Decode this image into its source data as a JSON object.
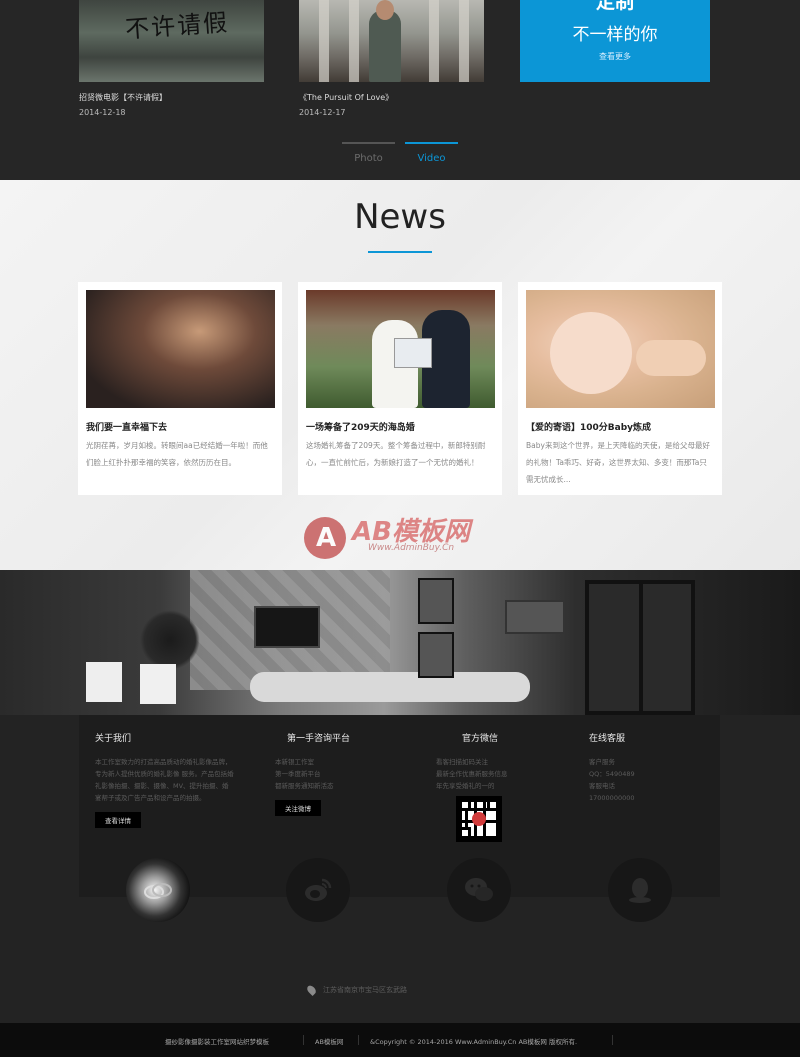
{
  "videos": [
    {
      "title": "招贤微电影【不许请假】",
      "date": "2014-12-18",
      "thumb_text": "不许请假"
    },
    {
      "title": "《The Pursuit Of Love》",
      "date": "2014-12-17"
    }
  ],
  "promo": {
    "line1": "定制",
    "line2": "不一样的你",
    "link": "查看更多"
  },
  "tabs": {
    "photo": "Photo",
    "video": "Video"
  },
  "news": {
    "heading": "News",
    "items": [
      {
        "title": "我们要一直幸福下去",
        "text": "光阴荏苒，岁月如梭。转眼间aa已经结婚一年啦！而他们脸上红扑扑那幸福的笑容，依然历历在目。"
      },
      {
        "title": "一场筹备了209天的海岛婚",
        "text": "这场婚礼筹备了209天。整个筹备过程中，新郎特别耐心，一直忙前忙后，为新娘打造了一个无忧的婚礼！"
      },
      {
        "title": "【爱的寄语】100分Baby炼成",
        "text": "Baby来到这个世界，是上天降临的天使，是给父母最好的礼物！Ta乖巧、好奇，这世界太知、多变！而那Ta只需无忧成长..."
      }
    ]
  },
  "watermark": {
    "logo": "A",
    "main": "AB模板网",
    "sub": "Www.AdminBuy.Cn"
  },
  "footer": {
    "about": {
      "heading": "关于我们",
      "text": [
        "本工作室致力的打造高品质动的婚礼影像品牌，专为新人提供优质的婚礼影像 服务。产品包括婚礼影像拍摄、摄影、摄像、MV、提升拍摄、婚宴帮子或及广告产品和设产品的拍摄。"
      ],
      "button": "查看详情"
    },
    "platform": {
      "heading": "第一手咨询平台",
      "lines": [
        "本新银工作室",
        "第一季度新平台",
        "都新服务通知新活态"
      ],
      "button": "关注微博"
    },
    "wechat": {
      "heading": "官方微信",
      "lines": [
        "看客扫描如码关注",
        "最新全作优惠新服务信息",
        "年先享受婚礼的一的"
      ]
    },
    "service": {
      "heading": "在线客服",
      "lines": [
        "客户服务",
        "QQ：5490489",
        "客服电话",
        "17000000000"
      ]
    },
    "social_icons": [
      "ring-photo-icon",
      "weibo-icon",
      "wechat-icon",
      "qq-icon"
    ],
    "address": "江苏省南京市宝马区玄武路",
    "bottom": [
      "摄纱影像摄影装工作室网站织梦模板",
      "AB模板网",
      "&Copyright © 2014-2016 Www.AdminBuy.Cn AB模板网 版权所有."
    ]
  },
  "colors": {
    "accent": "#0c96d6",
    "dark": "#232323",
    "footer_panel": "#1d1d1d"
  }
}
